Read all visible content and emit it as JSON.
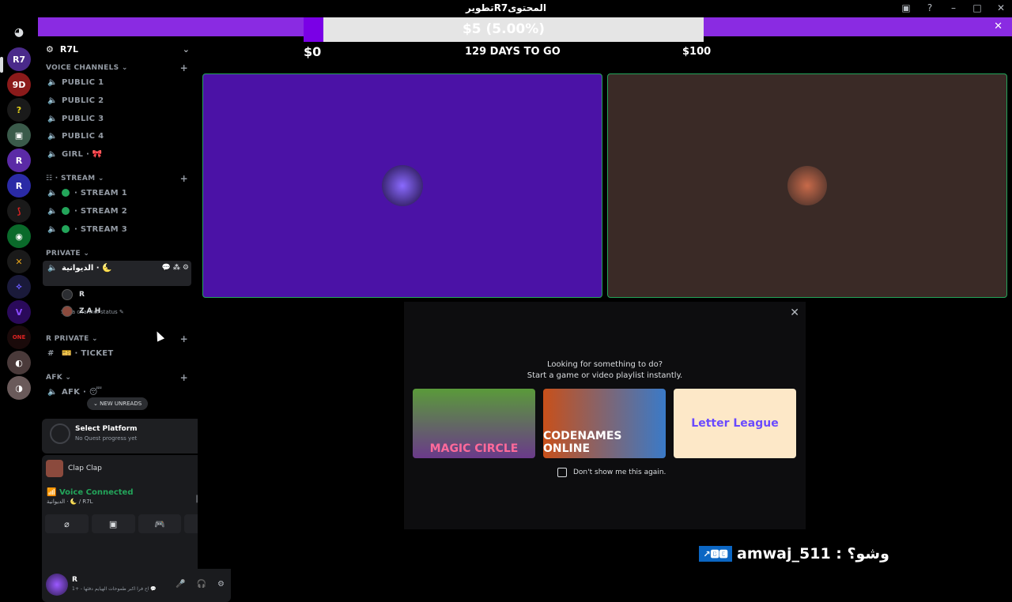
{
  "window": {
    "title": "تطويرR7المحتوى",
    "icons": [
      "screen-share-icon",
      "help-icon",
      "minimize-icon",
      "maximize-icon",
      "close-icon"
    ]
  },
  "banner": {
    "progress_text": "$5 (5.00%)",
    "progress": 0.05,
    "left_label": "$0",
    "center_label": "129 DAYS TO GO",
    "right_label": "$100",
    "close": "✕"
  },
  "server": {
    "name": "R7L"
  },
  "categories": {
    "voice": "VOICE CHANNELS",
    "stream": "STREAM",
    "private": "PRIVATE",
    "r_private": "R PRIVATE",
    "afk": "AFK",
    "plus": "+"
  },
  "channels": {
    "public1": "PUBLIC 1",
    "public2": "PUBLIC 2",
    "public3": "PUBLIC 3",
    "public4": "PUBLIC 4",
    "girl": "GIRL · 🎀",
    "stream1": "· STREAM 1",
    "stream2": "· STREAM 2",
    "stream3": "· STREAM 3",
    "private_room": "الديوانية · 🌜",
    "set_status": "Set a channel status ✎",
    "ticket": "🎫 · TICKET",
    "afk": "AFK · 😴"
  },
  "members": [
    "R",
    "Z A H"
  ],
  "new_unreads": "⌄ NEW UNREADS",
  "quest": {
    "title": "Select Platform",
    "subtitle": "No Quest progress yet"
  },
  "activity": {
    "name": "Clap Clap"
  },
  "voice": {
    "status": "Voice Connected",
    "location": "الديوانية · 🌜 / R7L"
  },
  "user": {
    "name": "R",
    "status": "اح فرا اكبر طموحات الهيايم دفئها - +1 💬"
  },
  "popup": {
    "line1": "Looking for something to do?",
    "line2": "Start a game or video playlist instantly.",
    "games": [
      "MAGIC CIRCLE",
      "CODENAMES ONLINE",
      "Letter League"
    ],
    "checkbox": "Don't show me this again."
  },
  "overlay": {
    "badge": "↗🅱🅴",
    "text": "amwaj_511 : وشو؟"
  },
  "colors": {
    "banner": "#8a2be2",
    "tile_left": "#4b12a6",
    "tile_right": "#3a2a26",
    "speaking": "#23a55a"
  }
}
